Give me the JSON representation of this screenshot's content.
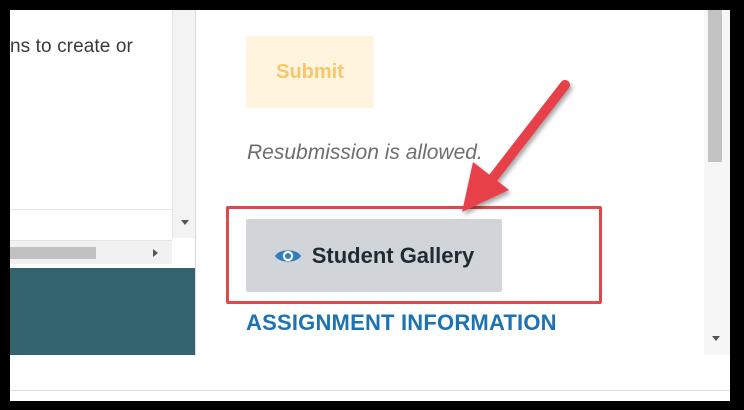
{
  "editor": {
    "visible_text": "ns to create or"
  },
  "assignment_panel": {
    "submit_label": "Submit",
    "resubmission_note": "Resubmission is allowed.",
    "student_gallery_label": "Student Gallery",
    "section_heading": "ASSIGNMENT INFORMATION"
  },
  "icons": {
    "gallery_icon": "eye-icon"
  },
  "colors": {
    "submit_bg": "#fff4de",
    "submit_text": "#f7c66b",
    "gallery_bg": "#d1d4d8",
    "eye_icon": "#2f7fc0",
    "section_heading": "#1c73b4",
    "highlight_box": "#e0484a",
    "annotation_arrow": "#e8404a",
    "editor_footer": "#34646e"
  }
}
